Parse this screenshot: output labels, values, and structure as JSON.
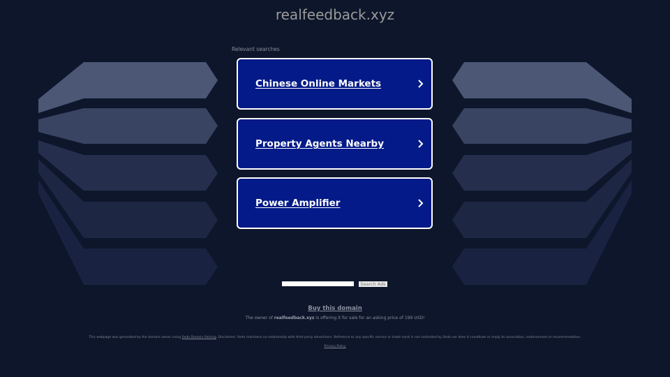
{
  "header": {
    "domain_title": "realfeedback.xyz"
  },
  "related": {
    "label": "Relevant searches",
    "items": [
      {
        "label": "Chinese Online Markets",
        "icon": "chevron-right-icon"
      },
      {
        "label": "Property Agents Nearby",
        "icon": "chevron-right-icon"
      },
      {
        "label": "Power Amplifier",
        "icon": "chevron-right-icon"
      }
    ]
  },
  "search": {
    "value": "",
    "placeholder": "",
    "button_label": "Search Ads"
  },
  "sale": {
    "buy_label": "Buy this domain",
    "owner_prefix": "The owner of ",
    "owner_domain": "realfeedback.xyz",
    "owner_suffix": " is offering it for sale for an asking price of 199 USD!"
  },
  "footer": {
    "disclaimer_prefix": "This webpage was generated by the domain owner using ",
    "disclaimer_link": "Sedo Domain Parking",
    "disclaimer_suffix": ". Disclaimer: Sedo maintains no relationship with third party advertisers. Reference to any specific service or trade mark is not controlled by Sedo nor does it constitute or imply its association, endorsement or recommendation.",
    "privacy_label": "Privacy Policy"
  },
  "colors": {
    "background": "#0e162b",
    "ad_box": "#031a88",
    "stack_shades": [
      "#4b5775",
      "#384462",
      "#252f4d",
      "#1d2744",
      "#192341"
    ]
  }
}
